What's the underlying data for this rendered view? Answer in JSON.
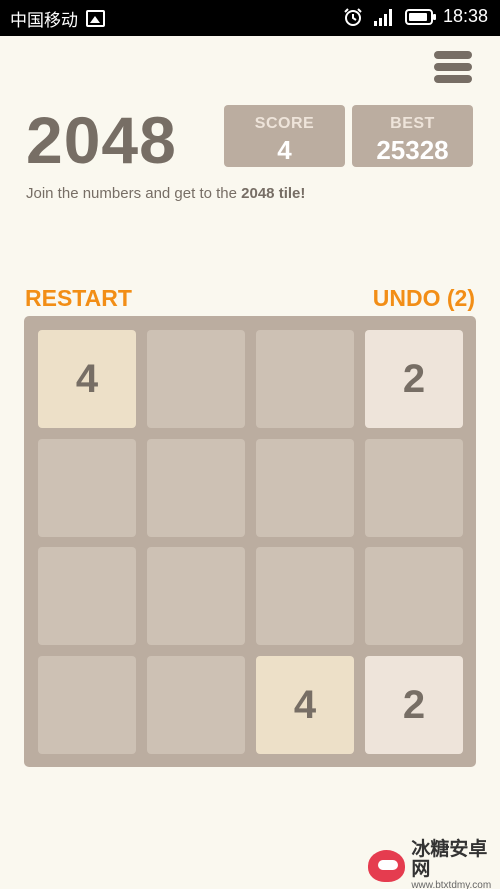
{
  "status_bar": {
    "carrier": "中国移动",
    "time": "18:38"
  },
  "game": {
    "title": "2048",
    "score_label": "SCORE",
    "score_value": "4",
    "best_label": "BEST",
    "best_value": "25328",
    "subtitle_prefix": "Join the numbers and get to the ",
    "subtitle_emphasis": "2048 tile!",
    "restart_label": "RESTART",
    "undo_label": "UNDO (2)"
  },
  "board": {
    "rows": [
      [
        "4",
        "",
        "",
        "2"
      ],
      [
        "",
        "",
        "",
        ""
      ],
      [
        "",
        "",
        "",
        ""
      ],
      [
        "",
        "",
        "4",
        "2"
      ]
    ],
    "colors": {
      "board": "#bbada0",
      "empty_cell": "#cdc1b4",
      "tile_2": "#eee4da",
      "tile_4": "#ede0c8",
      "text": "#776e65",
      "accent": "#f28e16"
    }
  },
  "watermark": {
    "title": "冰糖安卓网",
    "url": "www.btxtdmy.com"
  }
}
